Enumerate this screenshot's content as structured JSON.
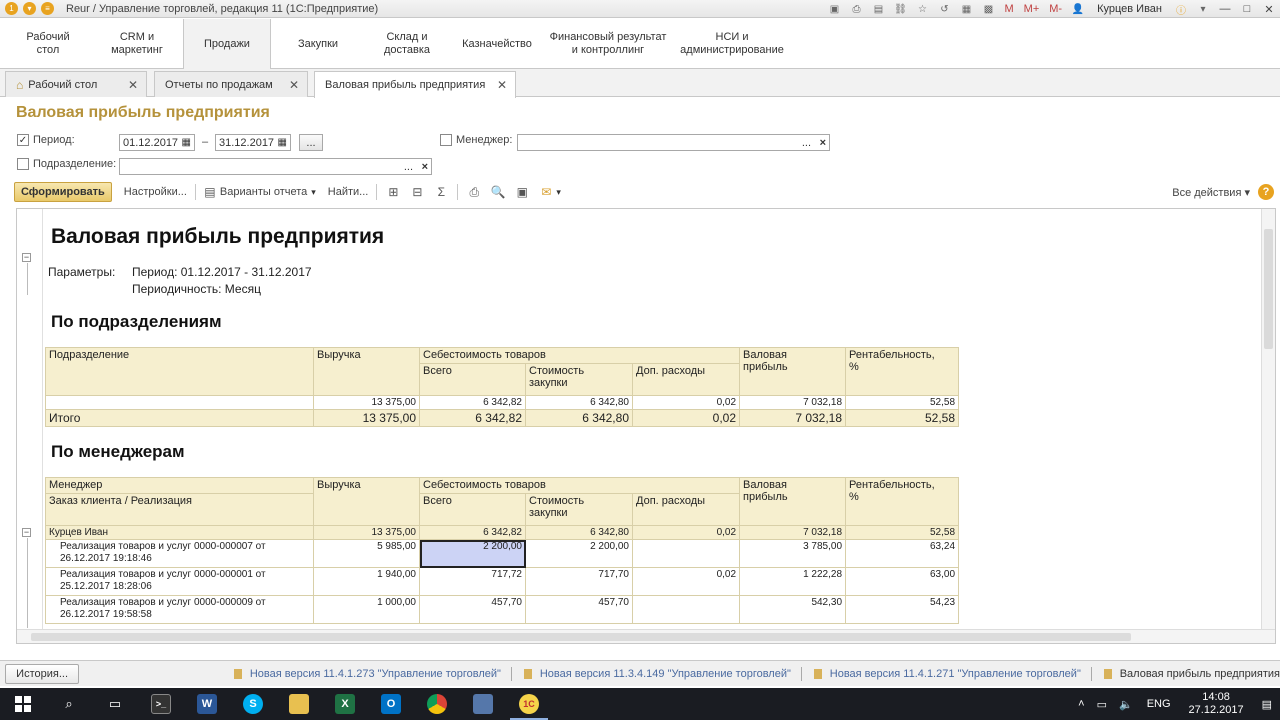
{
  "window": {
    "title": "Reur / Управление торговлей, редакция 11  (1С:Предприятие)",
    "m_buttons": [
      "M",
      "M+",
      "M-"
    ],
    "user": "Курцев Иван"
  },
  "sections": [
    {
      "label": "Рабочий\nстол"
    },
    {
      "label": "CRM и\nмаркетинг"
    },
    {
      "label": "Продажи"
    },
    {
      "label": "Закупки"
    },
    {
      "label": "Склад и\nдоставка"
    },
    {
      "label": "Казначейство"
    },
    {
      "label": "Финансовый результат\nи контроллинг"
    },
    {
      "label": "НСИ и\nадминистрирование"
    }
  ],
  "open_tabs": [
    {
      "label": "Рабочий стол"
    },
    {
      "label": "Отчеты по продажам"
    },
    {
      "label": "Валовая прибыль предприятия"
    }
  ],
  "form": {
    "title": "Валовая прибыль предприятия",
    "period_label": "Период:",
    "period_from": "01.12.2017",
    "period_dash": "–",
    "period_to": "31.12.2017",
    "ellipsis": "...",
    "manager_label": "Менеджер:",
    "manager_value": "",
    "division_label": "Подразделение:",
    "division_value": "",
    "clear": "×"
  },
  "toolbar": {
    "generate": "Сформировать",
    "settings": "Настройки...",
    "variants": "Варианты отчета",
    "find": "Найти...",
    "all_actions": "Все действия",
    "help": "?"
  },
  "report": {
    "title": "Валовая прибыль предприятия",
    "params_label": "Параметры:",
    "param1": "Период: 01.12.2017 - 31.12.2017",
    "param2": "Периодичность: Месяц",
    "section1": "По подразделениям",
    "section2": "По менеджерам",
    "headers": {
      "division": "Подразделение",
      "manager": "Менеджер",
      "order": "Заказ клиента / Реализация",
      "revenue": "Выручка",
      "cost": "Себестоимость товаров",
      "total": "Всего",
      "goods_cost": "Стоимость\nзакупки",
      "extra": "Доп. расходы",
      "gross": "Валовая\nприбыль",
      "profitability": "Рентабельность,\n%"
    },
    "div_rows": [
      {
        "name": "",
        "revenue": "13 375,00",
        "total": "6 342,82",
        "goods": "6 342,80",
        "extra": "0,02",
        "gross": "7 032,18",
        "prof": "52,58"
      }
    ],
    "div_total": {
      "name": "Итого",
      "revenue": "13 375,00",
      "total": "6 342,82",
      "goods": "6 342,80",
      "extra": "0,02",
      "gross": "7 032,18",
      "prof": "52,58"
    },
    "mgr_group": {
      "name": "Курцев Иван",
      "revenue": "13 375,00",
      "total": "6 342,82",
      "goods": "6 342,80",
      "extra": "0,02",
      "gross": "7 032,18",
      "prof": "52,58"
    },
    "mgr_rows": [
      {
        "name": "Реализация товаров и услуг 0000-000007 от 26.12.2017 19:18:46",
        "revenue": "5 985,00",
        "total": "2 200,00",
        "goods": "2 200,00",
        "extra": "",
        "gross": "3 785,00",
        "prof": "63,24"
      },
      {
        "name": "Реализация товаров и услуг 0000-000001 от 25.12.2017 18:28:06",
        "revenue": "1 940,00",
        "total": "717,72",
        "goods": "717,70",
        "extra": "0,02",
        "gross": "1 222,28",
        "prof": "63,00"
      },
      {
        "name": "Реализация товаров и услуг 0000-000009 от 26.12.2017 19:58:58",
        "revenue": "1 000,00",
        "total": "457,70",
        "goods": "457,70",
        "extra": "",
        "gross": "542,30",
        "prof": "54,23"
      }
    ]
  },
  "statusbar": {
    "history": "История...",
    "notifications": [
      "Новая версия 11.4.1.273 \"Управление торговлей\"",
      "Новая версия 11.3.4.149 \"Управление торговлей\"",
      "Новая версия 11.4.1.271 \"Управление торговлей\"",
      "Валовая прибыль предприятия"
    ]
  },
  "taskbar": {
    "lang": "ENG",
    "time": "14:08",
    "date": "27.12.2017",
    "apps": [
      "W",
      "S",
      "X",
      "O",
      "1C"
    ]
  },
  "colors": {
    "accent": "#b5923b",
    "header_bg": "#f6efcf",
    "selected_cell": "#ccd3f5"
  }
}
